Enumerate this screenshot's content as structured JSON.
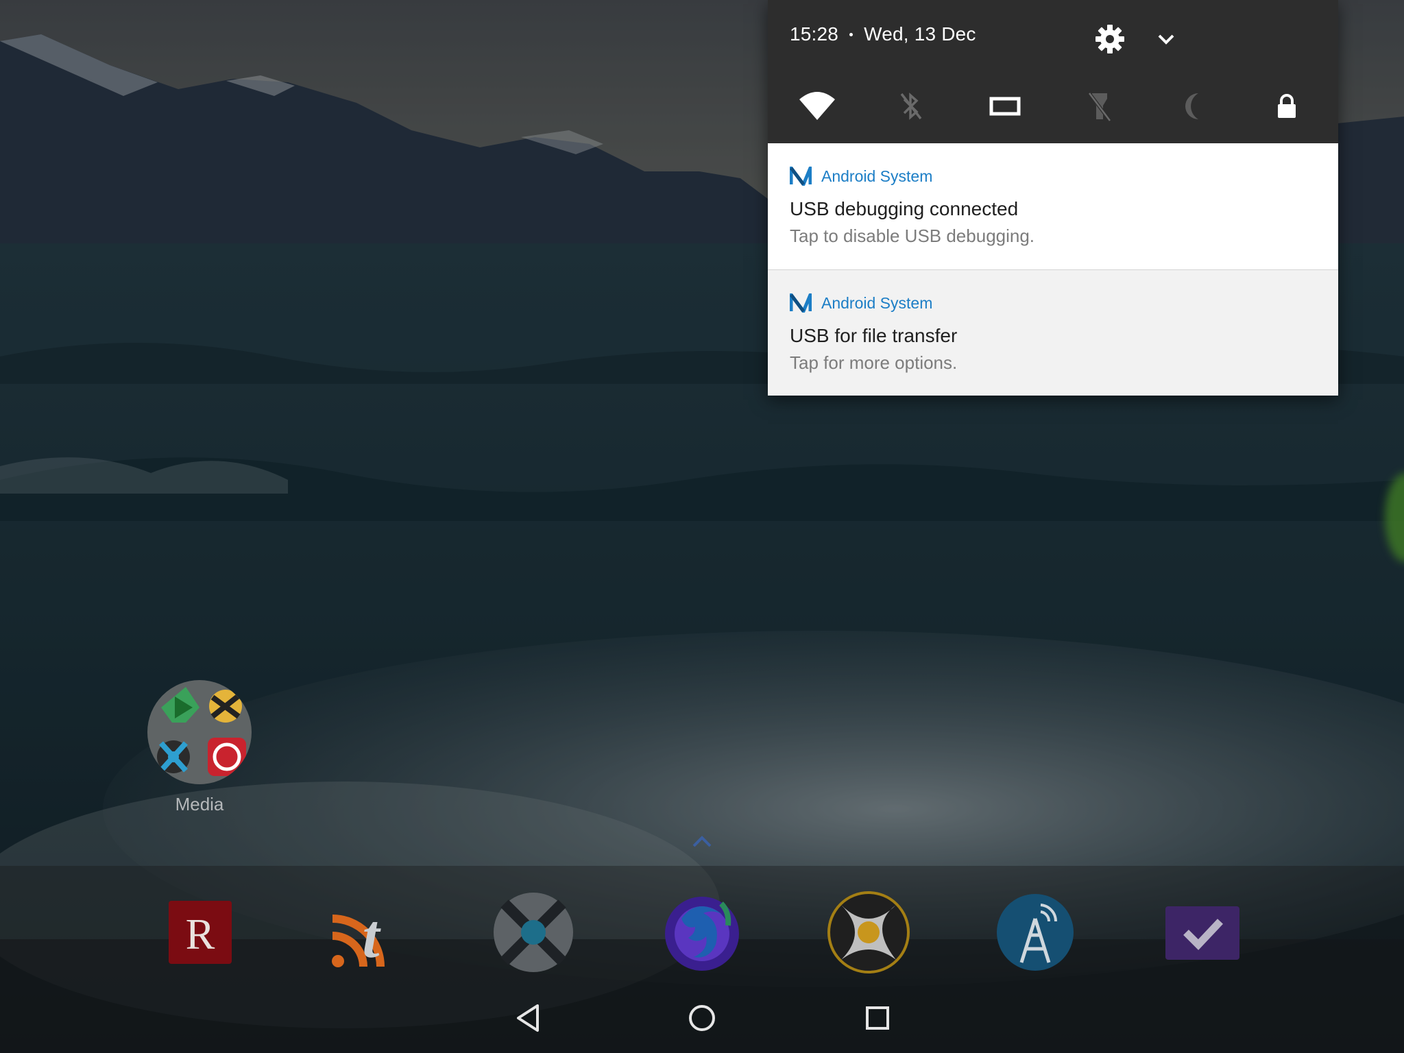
{
  "status": {
    "time": "15:28",
    "date": "Wed, 13 Dec"
  },
  "quick_settings": {
    "tiles": [
      {
        "icon": "wifi-icon",
        "state": "on"
      },
      {
        "icon": "bluetooth-off-icon",
        "state": "off"
      },
      {
        "icon": "screen-rotation-icon",
        "state": "on"
      },
      {
        "icon": "flashlight-off-icon",
        "state": "off"
      },
      {
        "icon": "do-not-disturb-moon-icon",
        "state": "off"
      },
      {
        "icon": "lock-icon",
        "state": "on"
      }
    ],
    "header_icons": [
      "settings-gear-icon",
      "expand-chevron-icon"
    ]
  },
  "notifications": [
    {
      "app": "Android System",
      "title": "USB debugging connected",
      "text": "Tap to disable USB debugging."
    },
    {
      "app": "Android System",
      "title": "USB for file transfer",
      "text": "Tap for more options."
    }
  ],
  "home": {
    "folder_label": "Media",
    "dock_apps": [
      {
        "icon": "r-app-icon",
        "color": "#8b0d14"
      },
      {
        "icon": "rss-t-app-icon",
        "color": "#e0701e"
      },
      {
        "icon": "x-player-app-icon",
        "color": "#1b6f8c"
      },
      {
        "icon": "firefox-nightly-icon",
        "color": "#4b2bb0"
      },
      {
        "icon": "kodi-like-app-icon",
        "color": "#d9a21a"
      },
      {
        "icon": "antenna-app-icon",
        "color": "#1a6f9a"
      },
      {
        "icon": "checkmark-app-icon",
        "color": "#4e2c7e"
      }
    ]
  },
  "navigation": [
    "back-icon",
    "home-icon",
    "recents-icon"
  ],
  "colors": {
    "shade_header": "#2d2d2d",
    "app_name_blue": "#1c7ec6",
    "notif_bg": "#ffffff"
  }
}
